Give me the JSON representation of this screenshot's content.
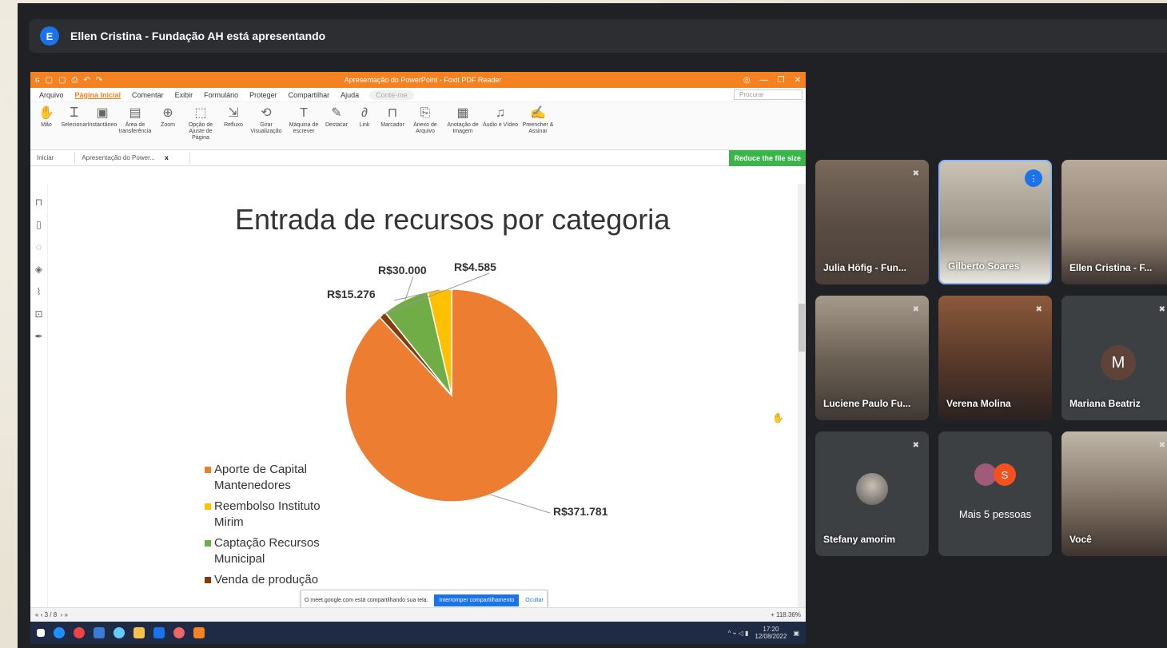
{
  "presenter": {
    "initial": "E",
    "text": "Ellen Cristina - Fundação AH está apresentando"
  },
  "app": {
    "title": "Apresentação do PowerPoint - Foxit PDF Reader",
    "menu": [
      "Arquivo",
      "Página Inicial",
      "Comentar",
      "Exibir",
      "Formulário",
      "Proteger",
      "Compartilhar",
      "Ajuda"
    ],
    "hint": "Conte-me",
    "search_placeholder": "Procurar",
    "ribbon": [
      {
        "icon": "hand-icon",
        "glyph": "✋",
        "label": "Mão"
      },
      {
        "icon": "select-icon",
        "glyph": "Ꮖ",
        "label": "Selecionar"
      },
      {
        "icon": "snapshot-icon",
        "glyph": "▣",
        "label": "Instantâneo"
      },
      {
        "icon": "clipboard-icon",
        "glyph": "▤",
        "label": "Área de transferência"
      },
      {
        "icon": "zoom-icon",
        "glyph": "⊕",
        "label": "Zoom"
      },
      {
        "icon": "fit-page-icon",
        "glyph": "⬚",
        "label": "Opção de Ajuste de Página"
      },
      {
        "icon": "reflow-icon",
        "glyph": "⇲",
        "label": "Refluxo"
      },
      {
        "icon": "rotate-icon",
        "glyph": "⟲",
        "label": "Girar Visualização"
      },
      {
        "icon": "typewriter-icon",
        "glyph": "T",
        "label": "Máquina de escrever"
      },
      {
        "icon": "highlight-icon",
        "glyph": "✎",
        "label": "Destacar"
      },
      {
        "icon": "link-icon",
        "glyph": "∂",
        "label": "Link"
      },
      {
        "icon": "bookmark-icon",
        "glyph": "⊓",
        "label": "Marcador"
      },
      {
        "icon": "attach-icon",
        "glyph": "⎘",
        "label": "Anexo de Arquivo"
      },
      {
        "icon": "image-annot-icon",
        "glyph": "▦",
        "label": "Anotação de Imagem"
      },
      {
        "icon": "media-icon",
        "glyph": "♫",
        "label": "Áudio e Vídeo"
      },
      {
        "icon": "sign-icon",
        "glyph": "✍",
        "label": "Preencher & Assinar"
      }
    ],
    "tabs": {
      "start": "Iniciar",
      "doc": "Apresentação do Power...",
      "close": "x"
    },
    "reduce_label": "Reduce the file size",
    "page_indicator": "3 / 8",
    "zoom_value": "+ 118.36%",
    "share_notice": "O meet.google.com está compartilhando sua tela.",
    "stop_sharing": "Interromper compartilhamento",
    "hide": "Ocultar",
    "clock_time": "17:20",
    "clock_date": "12/08/2022"
  },
  "chart_data": {
    "type": "pie",
    "title": "Entrada de recursos por categoria",
    "categories": [
      "Aporte de Capital Mantenedores",
      "Reembolso Instituto Mirim",
      "Captação Recursos Municipal",
      "Venda de produção"
    ],
    "values": [
      371781,
      15276,
      30000,
      4585
    ],
    "value_labels": [
      "R$371.781",
      "R$15.276",
      "R$30.000",
      "R$4.585"
    ],
    "colors": [
      "#ed7d31",
      "#ffc000",
      "#70ad47",
      "#843c0c"
    ],
    "legend_position": "left"
  },
  "participants": [
    {
      "name": "Julia Höfig - Fun...",
      "muted": true
    },
    {
      "name": "Gilberto Soares",
      "speaking": true
    },
    {
      "name": "Ellen Cristina - F..."
    },
    {
      "name": "Luciene Paulo Fu...",
      "muted": true
    },
    {
      "name": "Verena Molina",
      "muted": true
    },
    {
      "name": "Mariana Beatriz",
      "initial": "M",
      "muted": true
    },
    {
      "name": "Stefany amorim",
      "muted": true
    },
    {
      "name": "Mais 5 pessoas",
      "initial": "S"
    },
    {
      "name": "Você",
      "muted": true
    }
  ]
}
